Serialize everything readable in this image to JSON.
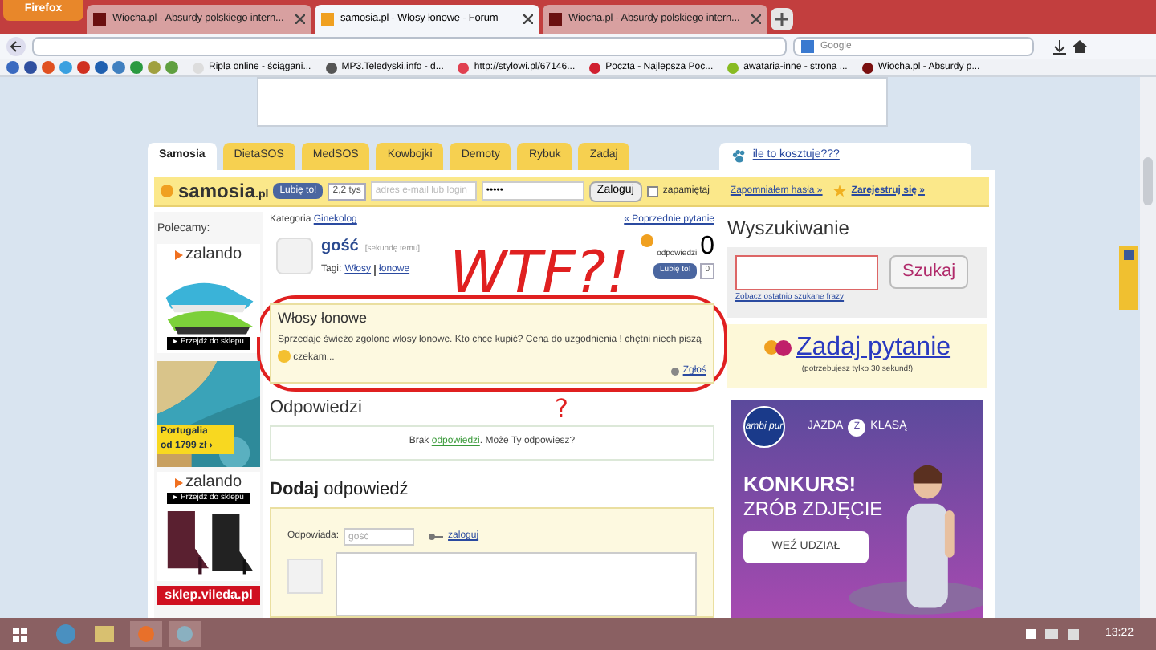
{
  "browser": {
    "app_button": "Firefox",
    "tabs": [
      {
        "title": "Wiocha.pl - Absurdy polskiego intern...",
        "selected": false
      },
      {
        "title": "samosia.pl - Włosy łonowe - Forum",
        "selected": true
      },
      {
        "title": "Wiocha.pl - Absurdy polskiego intern...",
        "selected": false
      }
    ],
    "search_placeholder": "Google",
    "bookmarks": [
      {
        "title": "Ripla online - ściągani...",
        "color": "#dddddd"
      },
      {
        "title": "MP3.Teledyski.info - d...",
        "color": "#555555"
      },
      {
        "title": "http://stylowi.pl/67146...",
        "color": "#e04050"
      },
      {
        "title": "Poczta - Najlepsza Poc...",
        "color": "#d02030"
      },
      {
        "title": "awatariа-inne - strona ...",
        "color": "#88bb22"
      },
      {
        "title": "Wiocha.pl - Absurdy p...",
        "color": "#7a1010"
      }
    ]
  },
  "site": {
    "tabs": [
      {
        "label": "Samosia",
        "selected": true
      },
      {
        "label": "DietaSOS",
        "selected": false
      },
      {
        "label": "MedSOS",
        "selected": false
      },
      {
        "label": "Kowbojki",
        "selected": false
      },
      {
        "label": "Demoty",
        "selected": false
      },
      {
        "label": "Rybuk",
        "selected": false
      },
      {
        "label": "Zadaj",
        "selected": false
      }
    ],
    "promo_tab": "ile to kosztuje???",
    "login": {
      "logo": "samosia",
      "logo_suffix": ".pl",
      "like": "Lubię to!",
      "like_count": "2,2 tys",
      "email_placeholder": "adres e-mail lub login",
      "password_value": "•••••",
      "button": "Zaloguj",
      "remember": {
        "label": "zapamiętaj",
        "checked": false
      },
      "forgot": "Zapomniałem hasła »",
      "register": "Zarejestruj się »"
    },
    "sidebar": {
      "heading": "Polecamy:",
      "ads": [
        {
          "kind": "shoe",
          "brand": "zalando",
          "cta": "▸ Przejdź do sklepu"
        },
        {
          "kind": "travel",
          "line1": "Portugalia",
          "line2": "od 1799 zł ›"
        },
        {
          "kind": "boots",
          "brand": "zalando",
          "cta": "▸ Przejdź do sklepu"
        }
      ],
      "footer_ad": "sklep.vileda.pl"
    },
    "question": {
      "category_label": "Kategoria",
      "category": "Ginekolog",
      "previous": "« Poprzednie pytanie",
      "author": "gość",
      "time": "[sekundę temu]",
      "tags_label": "Tagi:",
      "tags": [
        "Włosy",
        "łonowe"
      ],
      "answers_count": "0",
      "answers_label": "odpowiedzi",
      "like": "Lubię to!",
      "like_count": "0",
      "title": "Włosy łonowe",
      "body": "Sprzedaje świeżo zgolone włosy łonowe. Kto chce kupić? Cena do uzgodnienia ! chętni niech piszą",
      "body_end": "czekam...",
      "report": "Zgłoś"
    },
    "answers": {
      "heading": "Odpowiedzi",
      "empty_before": "Brak",
      "empty_link": "odpowiedzi",
      "empty_after": ". Może Ty odpowiesz?"
    },
    "add_answer": {
      "heading": "**Dodaj** odpowiedź",
      "author_label": "Odpowiada:",
      "author_placeholder": "gość",
      "login_link": "zaloguj"
    },
    "search": {
      "heading": "Wyszukiwanie",
      "button": "Szukaj",
      "recent_link": "Zobacz ostatnio szukane frazy"
    },
    "ask": {
      "title": "Zadaj pytanie",
      "subtitle": "(potrzebujesz tylko 30 sekund!)"
    },
    "ad": {
      "brand": "ambi pur",
      "slogan_left": "JAZDA",
      "slogan_mid": "Z",
      "slogan_right": "KLASĄ",
      "headline": "KONKURS!",
      "subline": "ZRÓB ZDJĘCIE",
      "cta": "WEŹ UDZIAŁ"
    }
  },
  "annotations": [
    {
      "kind": "text",
      "text": "WTF?!"
    },
    {
      "kind": "circle"
    },
    {
      "kind": "text",
      "text": "?"
    }
  ],
  "taskbar": {
    "clock": "13:22"
  }
}
